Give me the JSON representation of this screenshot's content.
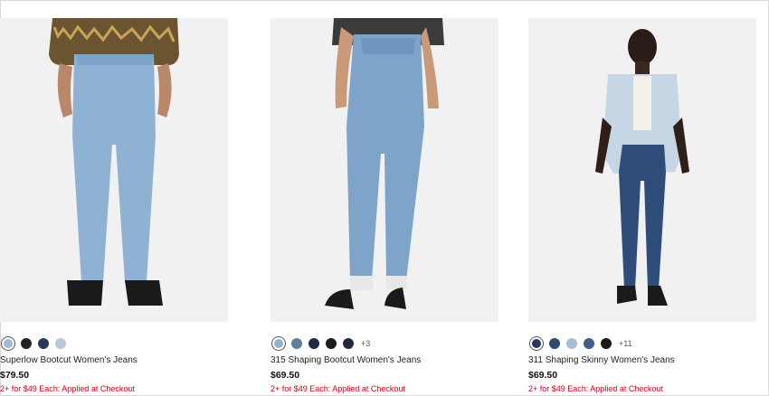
{
  "products": [
    {
      "title": "315 Shaping Bootcut Women's Jeans",
      "price": "$69.50",
      "promo": "2+ for $49 Each: Applied at Checkout",
      "swatches": [
        "#8fb3d1",
        "#5f7f9c",
        "#1f2a44",
        "#1c1c1c",
        "#202839"
      ],
      "more_colors": "+3"
    },
    {
      "title": "311 Shaping Skinny Women's Jeans",
      "price": "$69.50",
      "promo": "2+ for $49 Each: Applied at Checkout",
      "swatches": [
        "#253a5e",
        "#2f4a6b",
        "#a6bcd3",
        "#3f5e8c",
        "#1a1a1a"
      ],
      "more_colors": "+11"
    },
    {
      "title": "Superlow Bootcut Women's Jeans",
      "price": "$79.50",
      "promo": "2+ for $49 Each: Applied at Checkout",
      "swatches": [
        "#9fb9d4",
        "#1f2228",
        "#2a3a5a",
        "#b8c8d8"
      ],
      "more_colors": ""
    }
  ]
}
